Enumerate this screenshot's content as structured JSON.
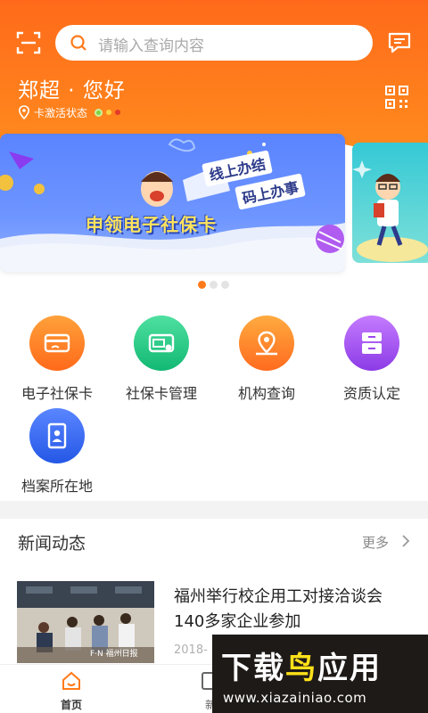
{
  "search": {
    "placeholder": "请输入查询内容"
  },
  "greeting": "郑超 · 您好",
  "card_status": {
    "label": "卡激活状态"
  },
  "banner": {
    "title": "申领电子社保卡",
    "slogan_line1": "线上办结",
    "slogan_line2": "码上办事",
    "active_index": 0,
    "page_count": 3
  },
  "services": [
    {
      "label": "电子社保卡",
      "icon": "card-icon",
      "color_top": "#ffa13a",
      "color_bottom": "#ff6a1a"
    },
    {
      "label": "社保卡管理",
      "icon": "card-manage-icon",
      "color_top": "#4fe0a0",
      "color_bottom": "#12b873"
    },
    {
      "label": "机构查询",
      "icon": "location-map-icon",
      "color_top": "#ffab40",
      "color_bottom": "#ff6b1e"
    },
    {
      "label": "资质认定",
      "icon": "cabinet-icon",
      "color_top": "#c57bff",
      "color_bottom": "#8c3be6"
    },
    {
      "label": "档案所在地",
      "icon": "archive-file-icon",
      "color_top": "#5a86ff",
      "color_bottom": "#2457e6"
    }
  ],
  "news": {
    "title": "新闻动态",
    "more_label": "更多",
    "items": [
      {
        "headline": "福州举行校企用工对接洽谈会　140多家企业参加",
        "date": "2018-",
        "thumb_caption": "F·N 福州日报"
      }
    ]
  },
  "tabbar": {
    "tabs": [
      {
        "label": "首页",
        "active": true
      },
      {
        "label": "新",
        "active": false
      }
    ],
    "active_color": "#ff7a1a"
  },
  "watermark": {
    "title_part1": "下载",
    "title_part2": "鸟",
    "title_part3": "应用",
    "url": "www.xiazainiao.com"
  }
}
